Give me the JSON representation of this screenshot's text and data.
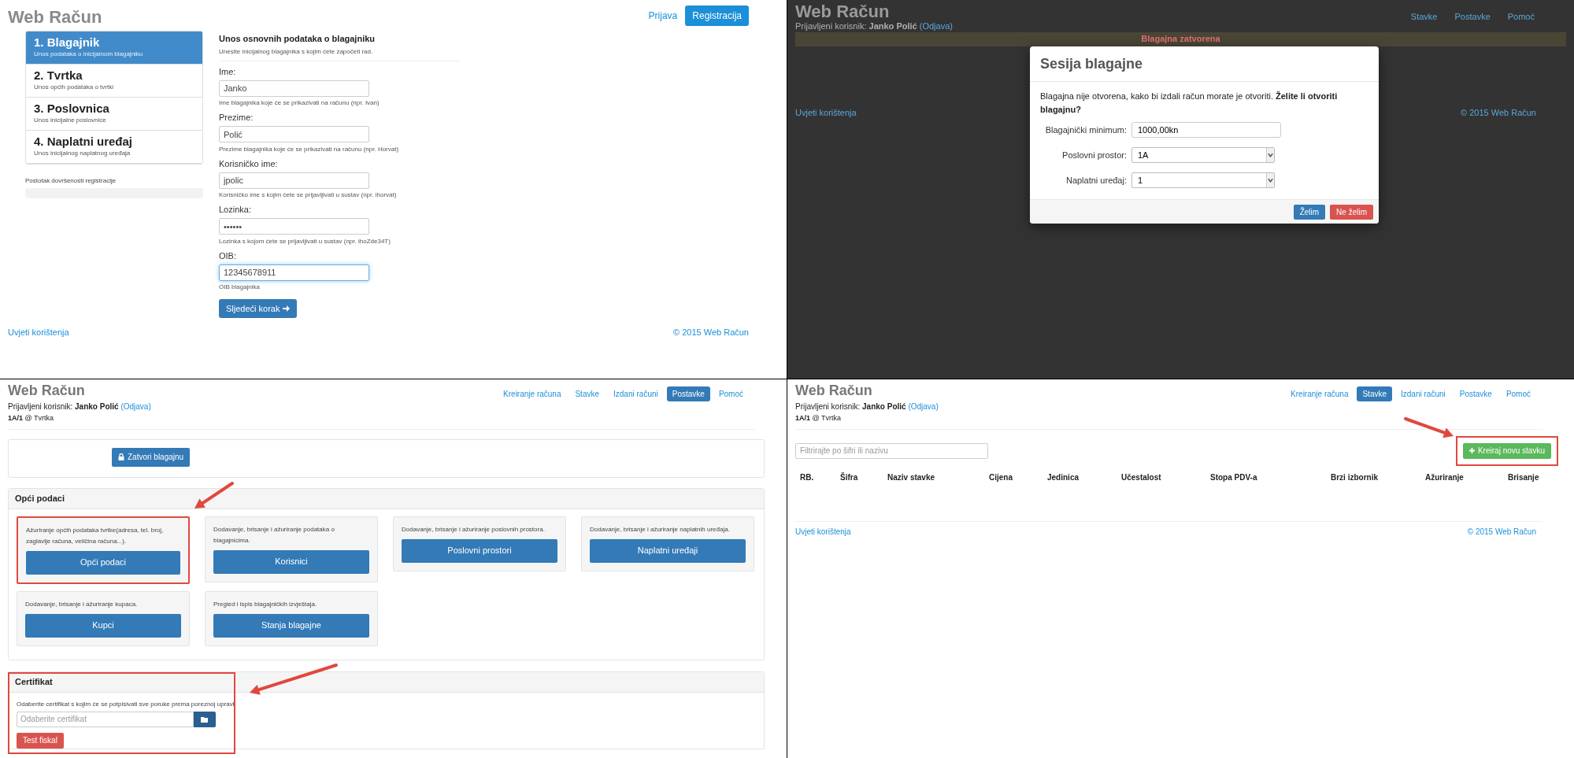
{
  "registration": {
    "app_title": "Web Račun",
    "nav": [
      {
        "label": "Prijava",
        "kind": "link"
      },
      {
        "label": "Registracija",
        "kind": "button"
      }
    ],
    "steps": [
      {
        "title": "1. Blagajnik",
        "subtitle": "Unos podataka o inicijalnom blagajniku",
        "selected": true
      },
      {
        "title": "2. Tvrtka",
        "subtitle": "Unos općih podataka o tvrtki",
        "selected": false
      },
      {
        "title": "3. Poslovnica",
        "subtitle": "Unos inicijalne poslovnice",
        "selected": false
      },
      {
        "title": "4. Naplatni uređaj",
        "subtitle": "Unos inicijalnog naplatnog uređaja",
        "selected": false
      }
    ],
    "progress": {
      "label": "Postotak dovršenosti registracije",
      "level": 0
    },
    "form": {
      "heading": "Unos osnovnih podataka o blagajniku",
      "subheading": "Unesite inicijalnog blagajnika s kojim ćete započeti rad.",
      "fields": [
        {
          "label": "Ime:",
          "value": "Janko",
          "help": "Ime blagajnika koje će se prikazivati na računu (npr. Ivan)",
          "focused": false
        },
        {
          "label": "Prezime:",
          "value": "Polić",
          "help": "Prezime blagajnika koje će se prikazivati na računu (npr. Horvat)",
          "focused": false
        },
        {
          "label": "Korisničko ime:",
          "value": "jpolic",
          "help": "Korisničko ime s kojim ćete se prijavljivati u sustav (npr. ihorvat)",
          "focused": false
        },
        {
          "label": "Lozinka:",
          "value": "••••••",
          "help": "Lozinka s kojom ćete se prijavljivati u sustav (npr. ihoZde34T)",
          "focused": false
        },
        {
          "label": "OIB:",
          "value": "12345678911",
          "help": "OIB blagajnika",
          "focused": true
        }
      ],
      "submit": "Sljedeći korak"
    },
    "footer": {
      "left": "Uvjeti korištenja",
      "right": "© 2015 Web Račun"
    }
  },
  "cash_session": {
    "background": {
      "app_title": "Web Račun",
      "user_label": "Prijavljeni korisnik:",
      "user_name": "Janko Polić",
      "logout": "(Odjava)",
      "nav": [
        "Stavke",
        "Postavke",
        "Pomoć"
      ],
      "alert": "Blagajna zatvorena",
      "footer": {
        "left": "Uvjeti korištenja",
        "right": "© 2015 Web Račun"
      }
    },
    "modal": {
      "title": "Sesija blagajne",
      "message": "Blagajna nije otvorena, kako bi izdali račun morate je otvoriti. **Želite li otvoriti blagajnu?**",
      "fields": [
        {
          "label": "Blagajnički minimum:",
          "value": "1000,00kn",
          "kind": "text"
        },
        {
          "label": "Poslovni prostor:",
          "value": "1A",
          "kind": "select"
        },
        {
          "label": "Naplatni uređaj:",
          "value": "1",
          "kind": "select"
        }
      ],
      "buttons": [
        {
          "label": "Želim",
          "kind": "primary"
        },
        {
          "label": "Ne želim",
          "kind": "danger"
        }
      ]
    }
  },
  "settings": {
    "app_title": "Web Račun",
    "user_label": "Prijavljeni korisnik:",
    "user_name": "Janko Polić",
    "logout": "(Odjava)",
    "location": "**1A/1** @ Tvrtka",
    "nav": [
      {
        "label": "Kreiranje računa",
        "selected": false
      },
      {
        "label": "Stavke",
        "selected": false
      },
      {
        "label": "Izdani računi",
        "selected": false
      },
      {
        "label": "Postavke",
        "selected": true
      },
      {
        "label": "Pomoć",
        "selected": false
      }
    ],
    "close_button": "Zatvori blagajnu",
    "general": {
      "title": "Opći podaci",
      "cards": [
        {
          "description": "Ažuriranje općih podataka tvrtke(adresa, tel. broj, zaglavlje računa, veličina računa...).",
          "button": "Opći podaci",
          "highlighted": true
        },
        {
          "description": "Dodavanje, brisanje i ažuriranje podataka o blagajnicima.",
          "button": "Korisnici",
          "highlighted": false
        },
        {
          "description": "Dodavanje, brisanje i ažuriranje poslovnih prostora.",
          "button": "Poslovni prostori",
          "highlighted": false
        },
        {
          "description": "Dodavanje, brisanje i ažuriranje naplatnih uređaja.",
          "button": "Naplatni uređaji",
          "highlighted": false
        },
        {
          "description": "Dodavanje, brisanje i ažuriranje kupaca.",
          "button": "Kupci",
          "highlighted": false
        },
        {
          "description": "Pregled i ispis blagajničkih izvještaja.",
          "button": "Stanja blagajne",
          "highlighted": false
        }
      ]
    },
    "certificate": {
      "title": "Certifikat",
      "description": "Odaberite certifikat s kojim će se potpisivati sve poruke prema poreznoj upravi.",
      "placeholder": "Odaberite certifikat",
      "test_button": "Test fiskal",
      "highlighted": true
    }
  },
  "items": {
    "app_title": "Web Račun",
    "user_label": "Prijavljeni korisnik:",
    "user_name": "Janko Polić",
    "logout": "(Odjava)",
    "location": "**1A/1** @ Tvrtka",
    "nav": [
      {
        "label": "Kreiranje računa",
        "selected": false
      },
      {
        "label": "Stavke",
        "selected": true
      },
      {
        "label": "Izdani računi",
        "selected": false
      },
      {
        "label": "Postavke",
        "selected": false
      },
      {
        "label": "Pomoć",
        "selected": false
      }
    ],
    "filter_placeholder": "Filtrirajte po šifri ili nazivu",
    "create_button": "Kreiraj novu stavku",
    "create_highlighted": true,
    "columns": [
      "RB.",
      "Šifra",
      "Naziv stavke",
      "Cijena",
      "Jedinica",
      "Učestalost",
      "Stopa PDV-a",
      "Brzi izbornik",
      "Ažuriranje",
      "Brisanje"
    ],
    "footer": {
      "left": "Uvjeti korištenja",
      "right": "© 2015 Web Račun"
    }
  }
}
